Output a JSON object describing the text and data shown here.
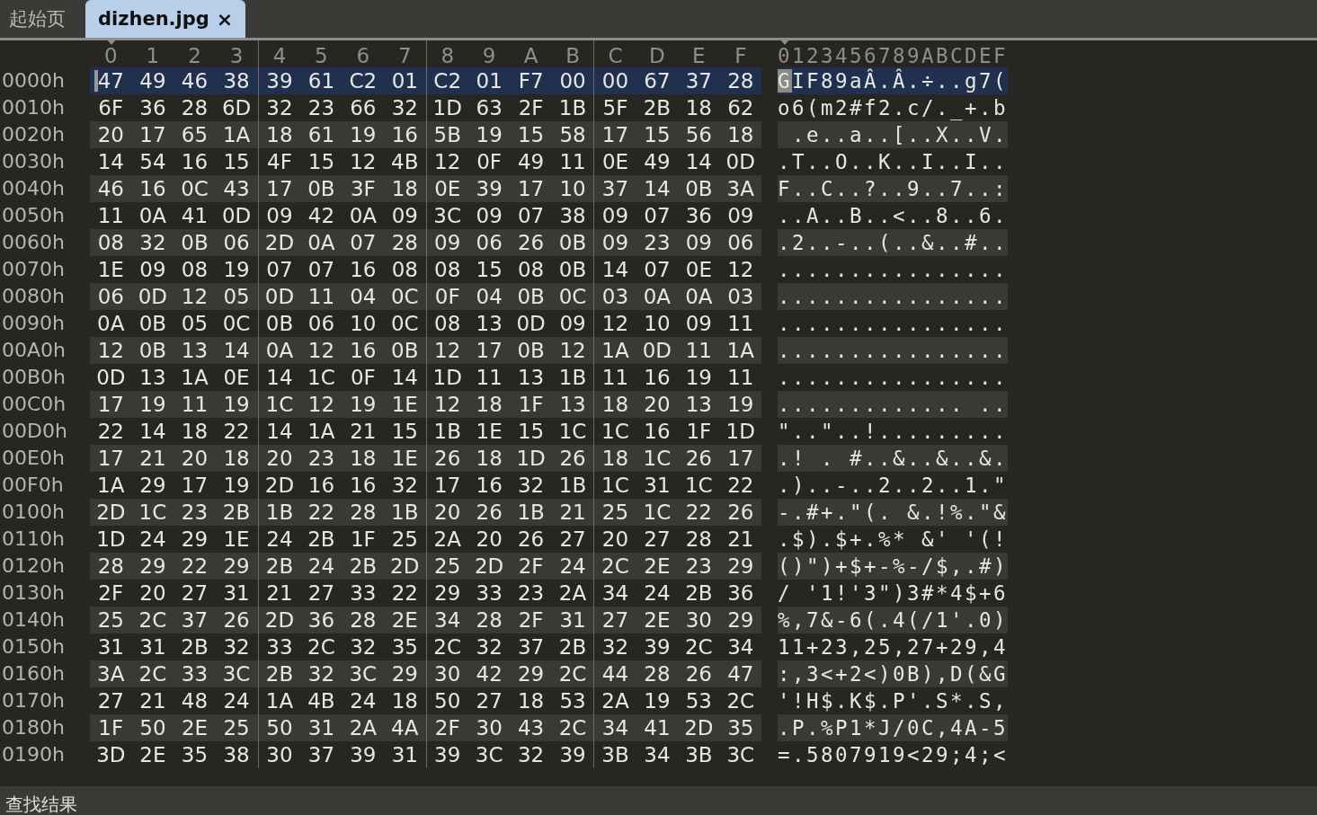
{
  "tabs": [
    {
      "label": "起始页",
      "selected": false
    },
    {
      "label": "dizhen.jpg",
      "selected": true,
      "close": "×"
    }
  ],
  "hex_view": {
    "columns": [
      {
        "label": "0",
        "current": true
      },
      {
        "label": "1",
        "current": false
      },
      {
        "label": "2",
        "current": false
      },
      {
        "label": "3",
        "current": false
      },
      {
        "label": "4",
        "current": false
      },
      {
        "label": "5",
        "current": false
      },
      {
        "label": "6",
        "current": false
      },
      {
        "label": "7",
        "current": false
      },
      {
        "label": "8",
        "current": false
      },
      {
        "label": "9",
        "current": false
      },
      {
        "label": "A",
        "current": false
      },
      {
        "label": "B",
        "current": false
      },
      {
        "label": "C",
        "current": false
      },
      {
        "label": "D",
        "current": false
      },
      {
        "label": "E",
        "current": false
      },
      {
        "label": "F",
        "current": false
      }
    ],
    "ascii_header": "0123456789ABCDEF",
    "rows": [
      {
        "offset": "0000h",
        "bytes": [
          "47",
          "49",
          "46",
          "38",
          "39",
          "61",
          "C2",
          "01",
          "C2",
          "01",
          "F7",
          "00",
          "00",
          "67",
          "37",
          "28"
        ],
        "ascii": "GIF89aÂ.Â.÷..g7(",
        "selected": true,
        "cursor": true
      },
      {
        "offset": "0010h",
        "bytes": [
          "6F",
          "36",
          "28",
          "6D",
          "32",
          "23",
          "66",
          "32",
          "1D",
          "63",
          "2F",
          "1B",
          "5F",
          "2B",
          "18",
          "62"
        ],
        "ascii": "o6(m2#f2.c/._+.b",
        "selected": false,
        "cursor": false
      },
      {
        "offset": "0020h",
        "bytes": [
          "20",
          "17",
          "65",
          "1A",
          "18",
          "61",
          "19",
          "16",
          "5B",
          "19",
          "15",
          "58",
          "17",
          "15",
          "56",
          "18"
        ],
        "ascii": " .e..a..[..X..V.",
        "selected": false,
        "cursor": false
      },
      {
        "offset": "0030h",
        "bytes": [
          "14",
          "54",
          "16",
          "15",
          "4F",
          "15",
          "12",
          "4B",
          "12",
          "0F",
          "49",
          "11",
          "0E",
          "49",
          "14",
          "0D"
        ],
        "ascii": ".T..O..K..I..I..",
        "selected": false,
        "cursor": false
      },
      {
        "offset": "0040h",
        "bytes": [
          "46",
          "16",
          "0C",
          "43",
          "17",
          "0B",
          "3F",
          "18",
          "0E",
          "39",
          "17",
          "10",
          "37",
          "14",
          "0B",
          "3A"
        ],
        "ascii": "F..C..?..9..7..:",
        "selected": false,
        "cursor": false
      },
      {
        "offset": "0050h",
        "bytes": [
          "11",
          "0A",
          "41",
          "0D",
          "09",
          "42",
          "0A",
          "09",
          "3C",
          "09",
          "07",
          "38",
          "09",
          "07",
          "36",
          "09"
        ],
        "ascii": "..A..B..<..8..6.",
        "selected": false,
        "cursor": false
      },
      {
        "offset": "0060h",
        "bytes": [
          "08",
          "32",
          "0B",
          "06",
          "2D",
          "0A",
          "07",
          "28",
          "09",
          "06",
          "26",
          "0B",
          "09",
          "23",
          "09",
          "06"
        ],
        "ascii": ".2..-..(..&..#..",
        "selected": false,
        "cursor": false
      },
      {
        "offset": "0070h",
        "bytes": [
          "1E",
          "09",
          "08",
          "19",
          "07",
          "07",
          "16",
          "08",
          "08",
          "15",
          "08",
          "0B",
          "14",
          "07",
          "0E",
          "12"
        ],
        "ascii": "................",
        "selected": false,
        "cursor": false
      },
      {
        "offset": "0080h",
        "bytes": [
          "06",
          "0D",
          "12",
          "05",
          "0D",
          "11",
          "04",
          "0C",
          "0F",
          "04",
          "0B",
          "0C",
          "03",
          "0A",
          "0A",
          "03"
        ],
        "ascii": "................",
        "selected": false,
        "cursor": false
      },
      {
        "offset": "0090h",
        "bytes": [
          "0A",
          "0B",
          "05",
          "0C",
          "0B",
          "06",
          "10",
          "0C",
          "08",
          "13",
          "0D",
          "09",
          "12",
          "10",
          "09",
          "11"
        ],
        "ascii": "................",
        "selected": false,
        "cursor": false
      },
      {
        "offset": "00A0h",
        "bytes": [
          "12",
          "0B",
          "13",
          "14",
          "0A",
          "12",
          "16",
          "0B",
          "12",
          "17",
          "0B",
          "12",
          "1A",
          "0D",
          "11",
          "1A"
        ],
        "ascii": "................",
        "selected": false,
        "cursor": false
      },
      {
        "offset": "00B0h",
        "bytes": [
          "0D",
          "13",
          "1A",
          "0E",
          "14",
          "1C",
          "0F",
          "14",
          "1D",
          "11",
          "13",
          "1B",
          "11",
          "16",
          "19",
          "11"
        ],
        "ascii": "................",
        "selected": false,
        "cursor": false
      },
      {
        "offset": "00C0h",
        "bytes": [
          "17",
          "19",
          "11",
          "19",
          "1C",
          "12",
          "19",
          "1E",
          "12",
          "18",
          "1F",
          "13",
          "18",
          "20",
          "13",
          "19"
        ],
        "ascii": "............. ..",
        "selected": false,
        "cursor": false
      },
      {
        "offset": "00D0h",
        "bytes": [
          "22",
          "14",
          "18",
          "22",
          "14",
          "1A",
          "21",
          "15",
          "1B",
          "1E",
          "15",
          "1C",
          "1C",
          "16",
          "1F",
          "1D"
        ],
        "ascii": "\"..\"..!.........",
        "selected": false,
        "cursor": false
      },
      {
        "offset": "00E0h",
        "bytes": [
          "17",
          "21",
          "20",
          "18",
          "20",
          "23",
          "18",
          "1E",
          "26",
          "18",
          "1D",
          "26",
          "18",
          "1C",
          "26",
          "17"
        ],
        "ascii": ".! . #..&..&..&.",
        "selected": false,
        "cursor": false
      },
      {
        "offset": "00F0h",
        "bytes": [
          "1A",
          "29",
          "17",
          "19",
          "2D",
          "16",
          "16",
          "32",
          "17",
          "16",
          "32",
          "1B",
          "1C",
          "31",
          "1C",
          "22"
        ],
        "ascii": ".)..-..2..2..1.\"",
        "selected": false,
        "cursor": false
      },
      {
        "offset": "0100h",
        "bytes": [
          "2D",
          "1C",
          "23",
          "2B",
          "1B",
          "22",
          "28",
          "1B",
          "20",
          "26",
          "1B",
          "21",
          "25",
          "1C",
          "22",
          "26"
        ],
        "ascii": "-.#+.\"(. &.!%.\"&",
        "selected": false,
        "cursor": false
      },
      {
        "offset": "0110h",
        "bytes": [
          "1D",
          "24",
          "29",
          "1E",
          "24",
          "2B",
          "1F",
          "25",
          "2A",
          "20",
          "26",
          "27",
          "20",
          "27",
          "28",
          "21"
        ],
        "ascii": ".$).$+.%* &' '(!",
        "selected": false,
        "cursor": false
      },
      {
        "offset": "0120h",
        "bytes": [
          "28",
          "29",
          "22",
          "29",
          "2B",
          "24",
          "2B",
          "2D",
          "25",
          "2D",
          "2F",
          "24",
          "2C",
          "2E",
          "23",
          "29"
        ],
        "ascii": "()\")+$+-%-/$,.#)",
        "selected": false,
        "cursor": false
      },
      {
        "offset": "0130h",
        "bytes": [
          "2F",
          "20",
          "27",
          "31",
          "21",
          "27",
          "33",
          "22",
          "29",
          "33",
          "23",
          "2A",
          "34",
          "24",
          "2B",
          "36"
        ],
        "ascii": "/ '1!'3\")3#*4$+6",
        "selected": false,
        "cursor": false
      },
      {
        "offset": "0140h",
        "bytes": [
          "25",
          "2C",
          "37",
          "26",
          "2D",
          "36",
          "28",
          "2E",
          "34",
          "28",
          "2F",
          "31",
          "27",
          "2E",
          "30",
          "29"
        ],
        "ascii": "%,7&-6(.4(/1'.0)",
        "selected": false,
        "cursor": false
      },
      {
        "offset": "0150h",
        "bytes": [
          "31",
          "31",
          "2B",
          "32",
          "33",
          "2C",
          "32",
          "35",
          "2C",
          "32",
          "37",
          "2B",
          "32",
          "39",
          "2C",
          "34"
        ],
        "ascii": "11+23,25,27+29,4",
        "selected": false,
        "cursor": false
      },
      {
        "offset": "0160h",
        "bytes": [
          "3A",
          "2C",
          "33",
          "3C",
          "2B",
          "32",
          "3C",
          "29",
          "30",
          "42",
          "29",
          "2C",
          "44",
          "28",
          "26",
          "47"
        ],
        "ascii": ":,3<+2<)0B),D(&G",
        "selected": false,
        "cursor": false
      },
      {
        "offset": "0170h",
        "bytes": [
          "27",
          "21",
          "48",
          "24",
          "1A",
          "4B",
          "24",
          "18",
          "50",
          "27",
          "18",
          "53",
          "2A",
          "19",
          "53",
          "2C"
        ],
        "ascii": "'!H$.K$.P'.S*.S,",
        "selected": false,
        "cursor": false
      },
      {
        "offset": "0180h",
        "bytes": [
          "1F",
          "50",
          "2E",
          "25",
          "50",
          "31",
          "2A",
          "4A",
          "2F",
          "30",
          "43",
          "2C",
          "34",
          "41",
          "2D",
          "35"
        ],
        "ascii": ".P.%P1*J/0C,4A-5",
        "selected": false,
        "cursor": false
      },
      {
        "offset": "0190h",
        "bytes": [
          "3D",
          "2E",
          "35",
          "38",
          "30",
          "37",
          "39",
          "31",
          "39",
          "3C",
          "32",
          "39",
          "3B",
          "34",
          "3B",
          "3C"
        ],
        "ascii": "=.5807919<29;4;<",
        "selected": false,
        "cursor": false
      }
    ]
  },
  "bottom_panel": {
    "title": "查找结果"
  }
}
